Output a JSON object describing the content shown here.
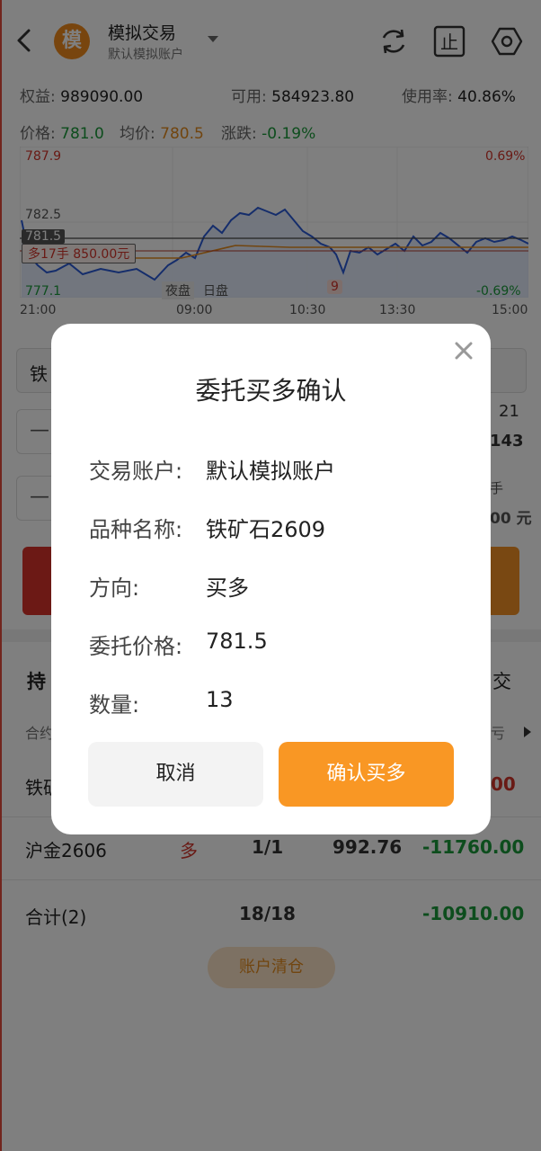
{
  "header": {
    "logo_text": "模",
    "title": "模拟交易",
    "subtitle": "默认模拟账户"
  },
  "stats": {
    "equity_label": "权益:",
    "equity_value": "989090.00",
    "available_label": "可用:",
    "available_value": "584923.80",
    "usage_label": "使用率:",
    "usage_value": "40.86%",
    "price_label": "价格:",
    "price_value": "781.0",
    "avg_label": "均价:",
    "avg_value": "780.5",
    "change_label": "涨跌:",
    "change_value": "-0.19%"
  },
  "chart": {
    "y_top": "787.9",
    "y_mid": "782.5",
    "y_current": "781.5",
    "y_bottom": "777.1",
    "pct_top": "0.69%",
    "pct_bottom": "-0.69%",
    "position_tag": "多17手 850.00元",
    "night_label": "夜盘",
    "day_label": "日盘",
    "marker_label": "9",
    "x_ticks": [
      "21:00",
      "09:00",
      "10:30",
      "13:30",
      "15:00"
    ]
  },
  "form": {
    "symbol_partial": "铁",
    "minus1": "—",
    "minus2": "—",
    "right_num1": "21",
    "right_num2": "143",
    "right_small1": "手",
    "right_small2": "00 元"
  },
  "positions": {
    "tab_label_partial": "持",
    "tab_right_partial": "交",
    "col_left_partial": "合约",
    "col_right_partial": "亏",
    "row1": {
      "name_partial": "铁矿",
      "pl_partial": "00"
    },
    "row2": {
      "name": "沪金2606",
      "dir": "多",
      "qty": "1/1",
      "price": "992.76",
      "pl": "-11760.00"
    },
    "total": {
      "label": "合计(2)",
      "qty": "18/18",
      "pl": "-10910.00"
    },
    "clear_button": "账户清仓"
  },
  "dialog": {
    "title": "委托买多确认",
    "rows": [
      {
        "label": "交易账户:",
        "value": "默认模拟账户"
      },
      {
        "label": "品种名称:",
        "value": "铁矿石2609"
      },
      {
        "label": "方向:",
        "value": "买多"
      },
      {
        "label": "委托价格:",
        "value": "781.5"
      },
      {
        "label": "数量:",
        "value": "13"
      }
    ],
    "cancel_label": "取消",
    "confirm_label": "确认买多"
  },
  "colors": {
    "accent": "#f99724",
    "up": "#d2342a",
    "down": "#1a9a3a",
    "line": "#2a5bd7"
  }
}
